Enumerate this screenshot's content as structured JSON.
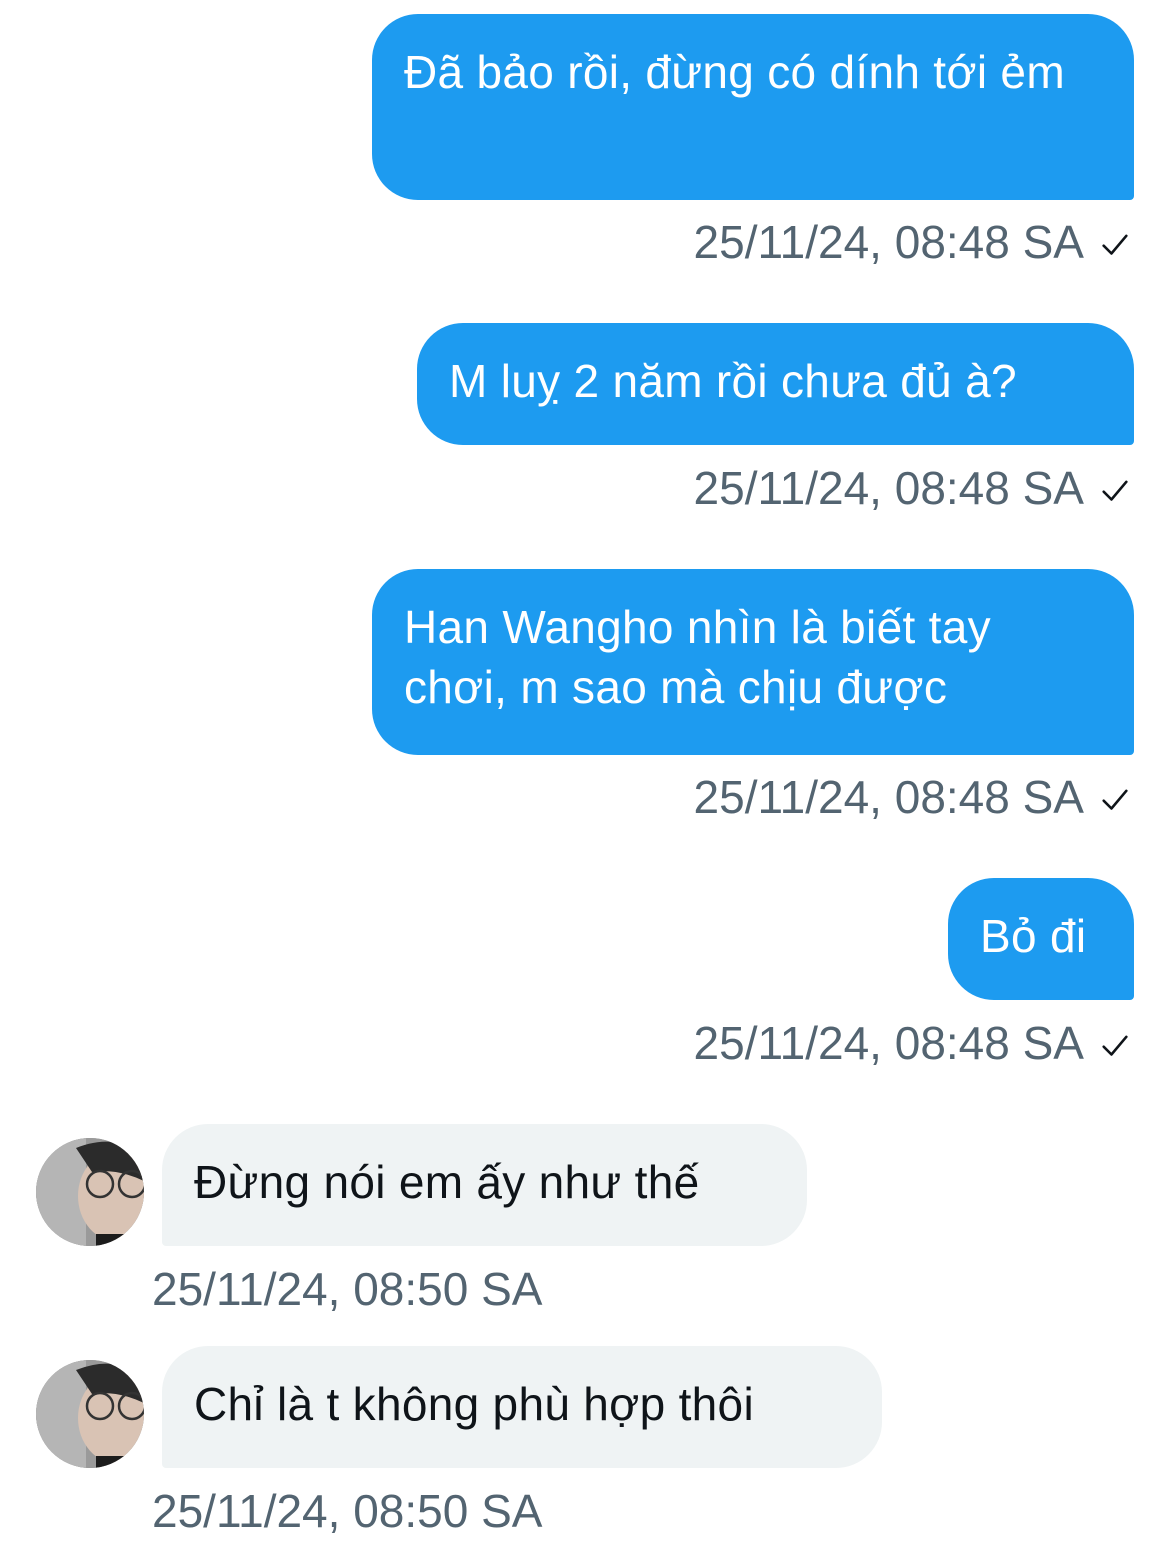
{
  "messages": [
    {
      "direction": "out",
      "text": "Đã bảo rồi, đừng có dính tới ẻm",
      "timestamp": "25/11/24, 08:48 SA",
      "status_icon": "check-icon"
    },
    {
      "direction": "out",
      "text": "M luỵ 2 năm rồi chưa đủ à?",
      "timestamp": "25/11/24, 08:48 SA",
      "status_icon": "check-icon"
    },
    {
      "direction": "out",
      "text": "Han Wangho nhìn là biết tay chơi, m sao mà chịu được",
      "timestamp": "25/11/24, 08:48 SA",
      "status_icon": "check-icon"
    },
    {
      "direction": "out",
      "text": "Bỏ đi",
      "timestamp": "25/11/24, 08:48 SA",
      "status_icon": "check-icon"
    },
    {
      "direction": "in",
      "text": "Đừng nói em ấy như thế",
      "timestamp": "25/11/24, 08:50 SA",
      "avatar_icon": "avatar"
    },
    {
      "direction": "in",
      "text": "Chỉ là t không phù hợp thôi",
      "timestamp": "25/11/24, 08:50 SA",
      "avatar_icon": "avatar"
    }
  ],
  "colors": {
    "outgoing_bubble": "#1d9bf0",
    "incoming_bubble": "#eff3f4",
    "timestamp_text": "#536471"
  }
}
